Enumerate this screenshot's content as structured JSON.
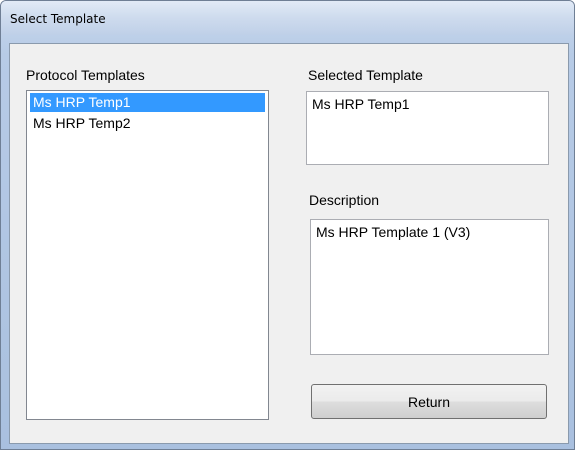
{
  "window": {
    "title": "Select Template"
  },
  "protocol_templates": {
    "label": "Protocol Templates",
    "items": [
      {
        "label": "Ms HRP Temp1",
        "selected": true
      },
      {
        "label": "Ms HRP Temp2",
        "selected": false
      }
    ]
  },
  "selected_template": {
    "label": "Selected Template",
    "value": "Ms HRP Temp1"
  },
  "description": {
    "label": "Description",
    "value": "Ms HRP Template 1 (V3)"
  },
  "buttons": {
    "return_label": "Return"
  },
  "colors": {
    "selection": "#3399ff",
    "dialog_background": "#f0f0f0",
    "title_bar": "#cfdcee"
  }
}
